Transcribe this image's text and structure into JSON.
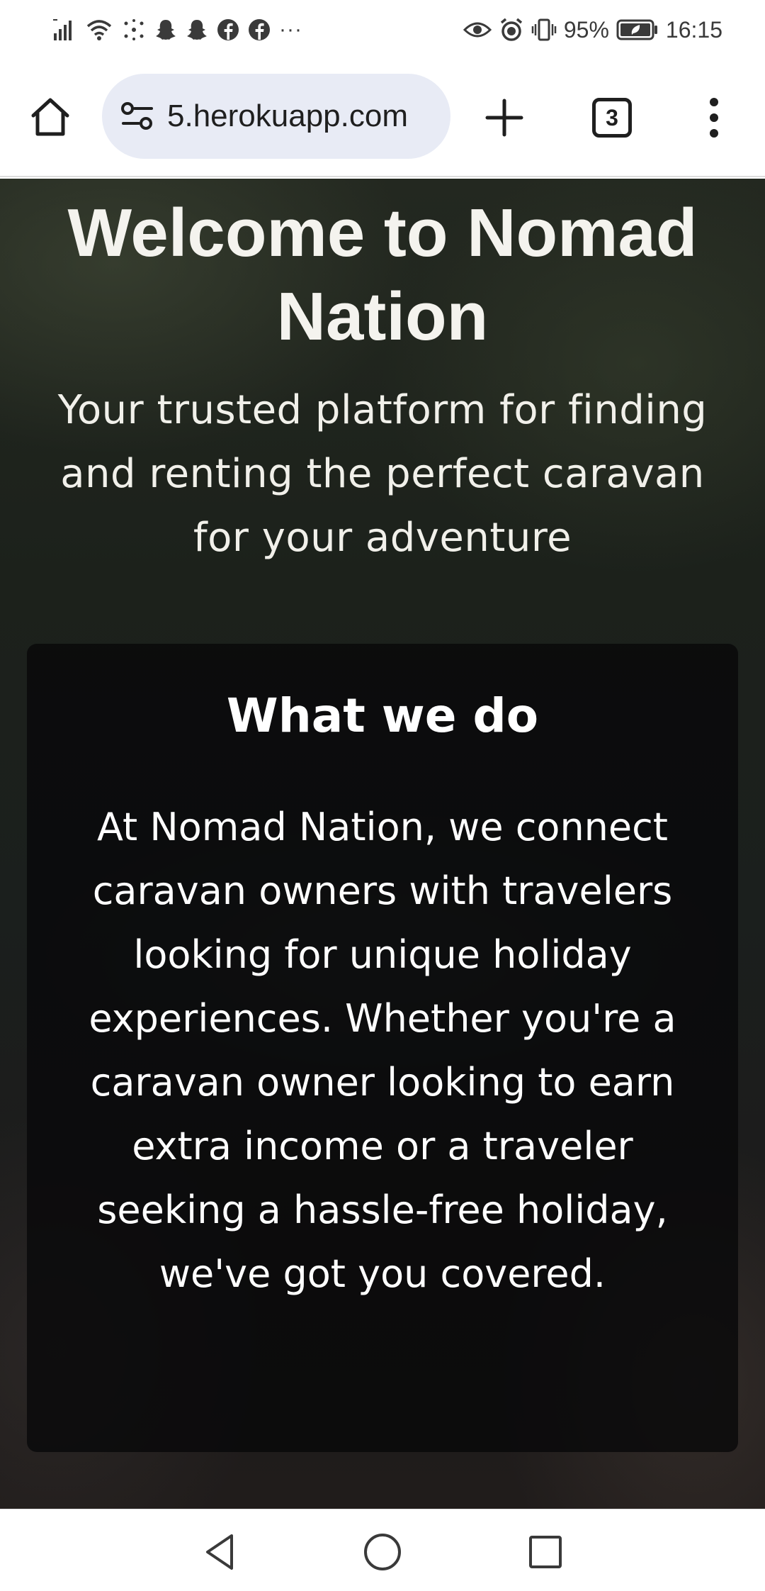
{
  "status_bar": {
    "battery": "95%",
    "time": "16:15",
    "more": "···",
    "icons": [
      "signal-icon",
      "wifi-icon",
      "hotspot-icon",
      "snapchat-icon",
      "snapchat-icon",
      "facebook-icon",
      "facebook-icon",
      "eye-icon",
      "alarm-icon",
      "vibrate-icon",
      "battery-icon"
    ]
  },
  "browser": {
    "url": "5.herokuapp.com",
    "tab_count": "3",
    "icons": {
      "home": "home-icon",
      "site_info": "tune-icon",
      "new_tab": "plus-icon",
      "menu": "more-vert-icon"
    }
  },
  "hero": {
    "title": "Welcome to Nomad Nation",
    "subtitle": "Your trusted platform for finding and renting the perfect caravan for your adventure"
  },
  "about": {
    "title": "What we do",
    "body": "At Nomad Nation, we connect caravan owners with travelers looking for unique holiday experiences. Whether you're a caravan owner looking to earn extra income or a traveler seeking a hassle-free holiday, we've got you covered."
  },
  "nav_bar": {
    "icons": [
      "back-icon",
      "home-circle-icon",
      "recents-icon"
    ]
  }
}
